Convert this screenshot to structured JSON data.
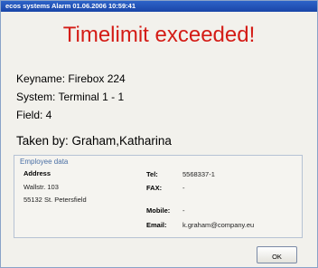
{
  "window": {
    "title": "ecos systems Alarm 01.06.2006 10:59:41"
  },
  "alarm": {
    "heading": "Timelimit exceeded!",
    "keyname": "Keyname: Firebox 224",
    "system": "System: Terminal 1 - 1",
    "field": "Field: 4",
    "taken_by": "Taken by: Graham,Katharina"
  },
  "employee": {
    "legend": "Employee data",
    "address_label": "Address",
    "address_line1": "Wallstr. 103",
    "address_line2": "55132   St. Petersfield",
    "tel_label": "Tel:",
    "tel_value": "5568337-1",
    "fax_label": "FAX:",
    "fax_value": "-",
    "mobile_label": "Mobile:",
    "mobile_value": "-",
    "email_label": "Email:",
    "email_value": "k.graham@company.eu"
  },
  "buttons": {
    "ok": "OK"
  }
}
